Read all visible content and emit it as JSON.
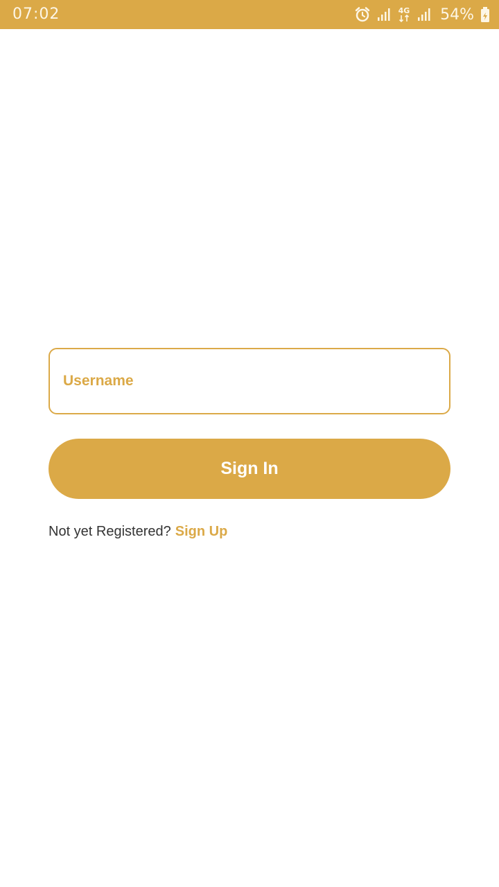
{
  "status_bar": {
    "time": "07:02",
    "network_type": "4G",
    "battery": "54%",
    "icons": [
      "alarm-icon",
      "signal-icon",
      "network-4g-icon",
      "signal-icon",
      "battery-charging-icon"
    ]
  },
  "login": {
    "username_placeholder": "Username",
    "username_value": "",
    "signin_label": "Sign In",
    "register_prompt": "Not yet Registered?",
    "signup_label": "Sign Up"
  },
  "colors": {
    "accent": "#dba947",
    "background": "#ffffff",
    "text": "#333333"
  }
}
